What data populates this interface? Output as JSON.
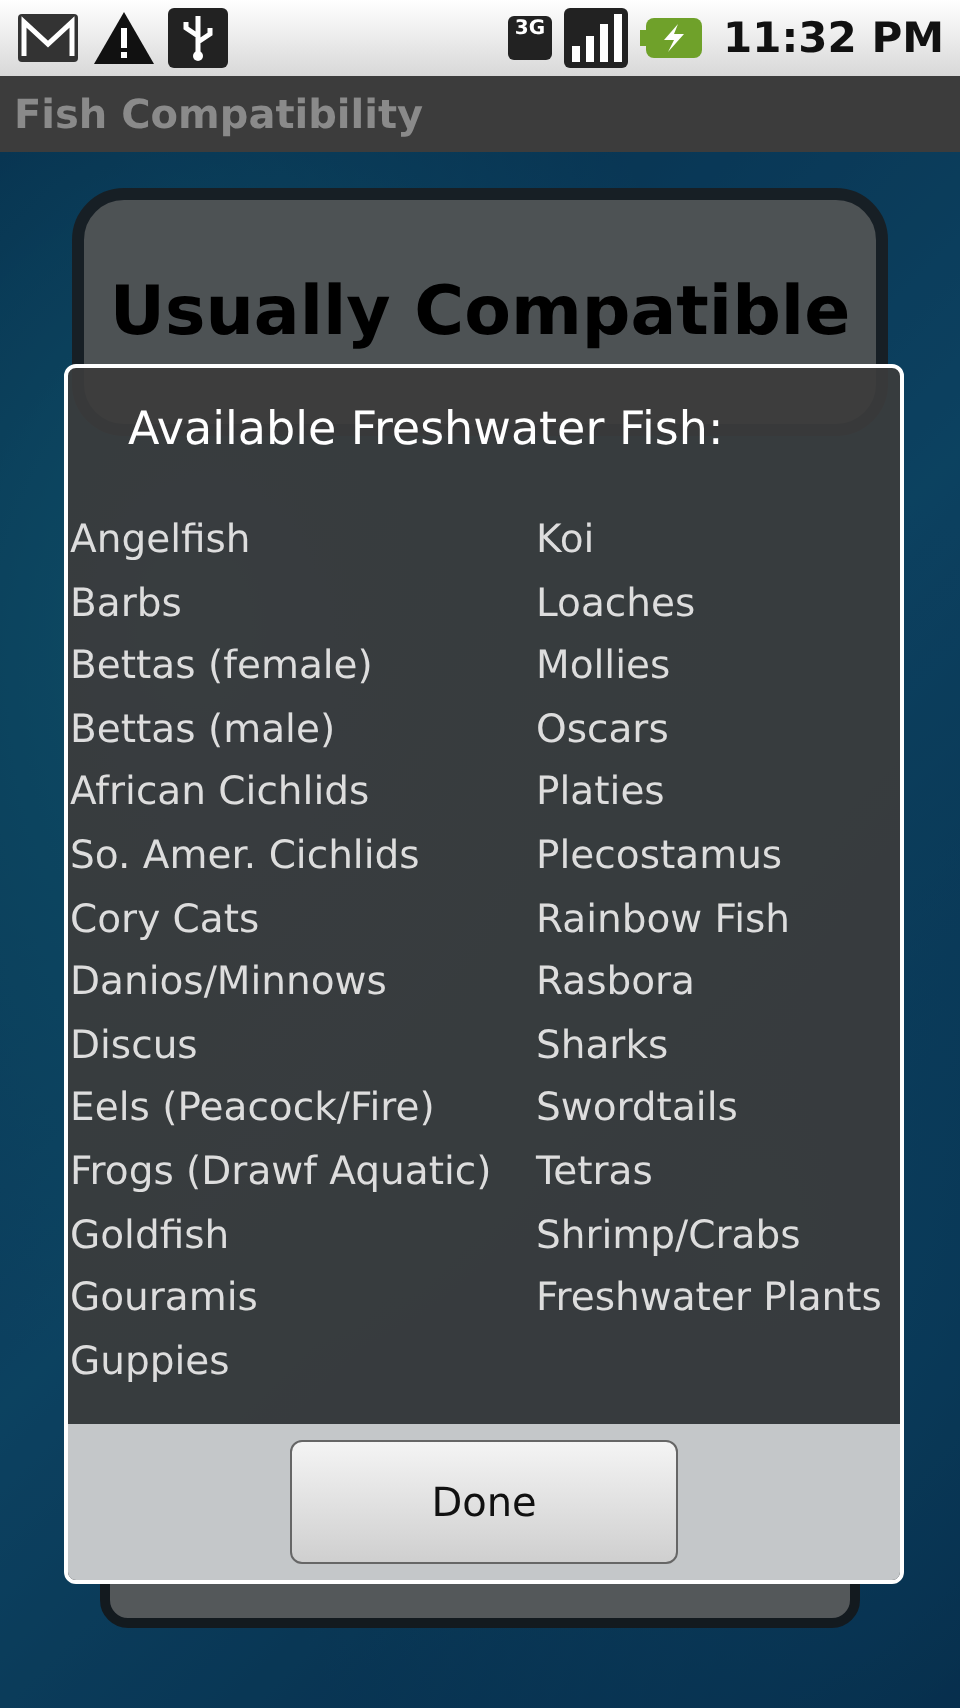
{
  "status_bar": {
    "network": "3G",
    "time": "11:32 PM"
  },
  "app_bar": {
    "title": "Fish Compatibility"
  },
  "result_card": {
    "title": "Usually Compatible"
  },
  "dialog": {
    "title": "Available Freshwater Fish:",
    "columns": [
      [
        "Angelfish",
        "Barbs",
        "Bettas (female)",
        "Bettas (male)",
        "African Cichlids",
        "So. Amer. Cichlids",
        "Cory Cats",
        "Danios/Minnows",
        "Discus",
        "Eels (Peacock/Fire)",
        "Frogs (Drawf Aquatic)",
        "Goldfish",
        "Gouramis",
        "Guppies"
      ],
      [
        "Koi",
        "Loaches",
        "Mollies",
        "Oscars",
        "Platies",
        "Plecostamus",
        "Rainbow Fish",
        "Rasbora",
        "Sharks",
        "Swordtails",
        "Tetras",
        "Shrimp/Crabs",
        "Freshwater Plants"
      ]
    ],
    "button": "Done"
  }
}
